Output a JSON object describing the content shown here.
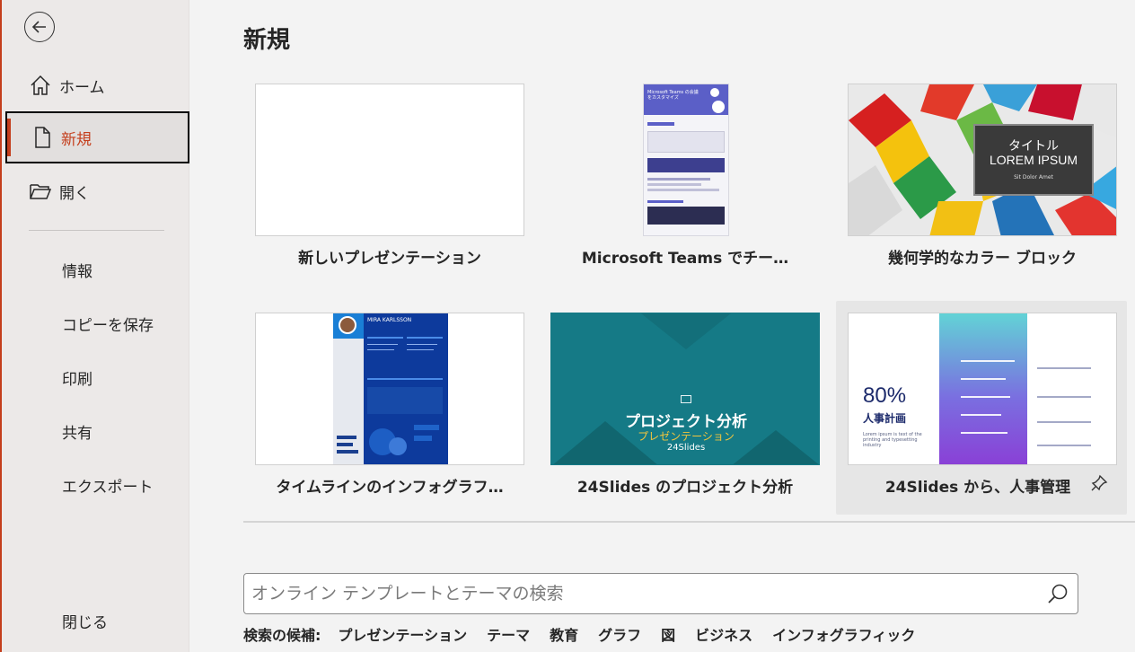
{
  "sidebar": {
    "back_label": "戻る",
    "items": [
      {
        "label": "ホーム",
        "icon": "home-icon"
      },
      {
        "label": "新規",
        "icon": "new-file-icon"
      },
      {
        "label": "開く",
        "icon": "open-folder-icon"
      }
    ],
    "sub_items": [
      "情報",
      "コピーを保存",
      "印刷",
      "共有",
      "エクスポート"
    ],
    "close_label": "閉じる",
    "accent": "#c43e1c"
  },
  "main": {
    "title": "新規",
    "templates": [
      {
        "label": "新しいプレゼンテーション"
      },
      {
        "label": "Microsoft Teams でチー…",
        "thumb_title": "Microsoft Teams の会議をカスタマイズ"
      },
      {
        "label": "幾何学的なカラー ブロック",
        "thumb_title": "タイトル LOREM IPSUM",
        "thumb_sub": "Sit Dolor Amet"
      },
      {
        "label": "タイムラインのインフォグラフ…",
        "thumb_name": "MIRA KARLSSON"
      },
      {
        "label": "24Slides のプロジェクト分析",
        "thumb_title": "プロジェクト分析",
        "thumb_sub": "プレゼンテーション",
        "thumb_brand": "24Slides"
      },
      {
        "label": "24Slides から、人事管理",
        "thumb_big": "80%",
        "thumb_title": "人事計画",
        "thumb_text": "Lorem ipsum is text of the printing and typesetting industry"
      }
    ],
    "search": {
      "placeholder": "オンライン テンプレートとテーマの検索"
    },
    "suggestions": {
      "label": "検索の候補:",
      "items": [
        "プレゼンテーション",
        "テーマ",
        "教育",
        "グラフ",
        "図",
        "ビジネス",
        "インフォグラフィック"
      ]
    }
  }
}
